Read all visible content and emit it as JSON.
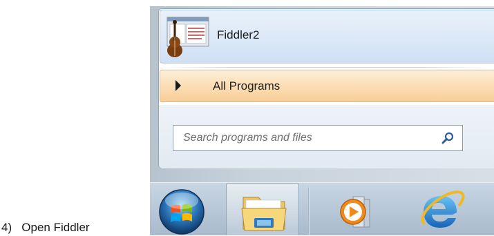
{
  "instruction": {
    "number": "4)",
    "text": "Open Fiddler"
  },
  "start_menu": {
    "pinned_program": {
      "label": "Fiddler2",
      "icon": "fiddler-violin-icon"
    },
    "all_programs": {
      "label": "All Programs",
      "icon": "triangle-right-icon"
    },
    "search": {
      "placeholder": "Search programs and files",
      "icon": "magnifier-icon"
    }
  },
  "taskbar": {
    "items": [
      {
        "name": "start-orb",
        "icon": "windows-logo-icon"
      },
      {
        "name": "windows-explorer",
        "icon": "folder-icon"
      },
      {
        "name": "windows-media-player",
        "icon": "media-player-icon"
      },
      {
        "name": "internet-explorer",
        "icon": "ie-logo-icon"
      }
    ]
  },
  "colors": {
    "highlight_blue": "#dde9f7",
    "hover_orange": "#fbdcb2",
    "taskbar": "#b8c8d8"
  }
}
